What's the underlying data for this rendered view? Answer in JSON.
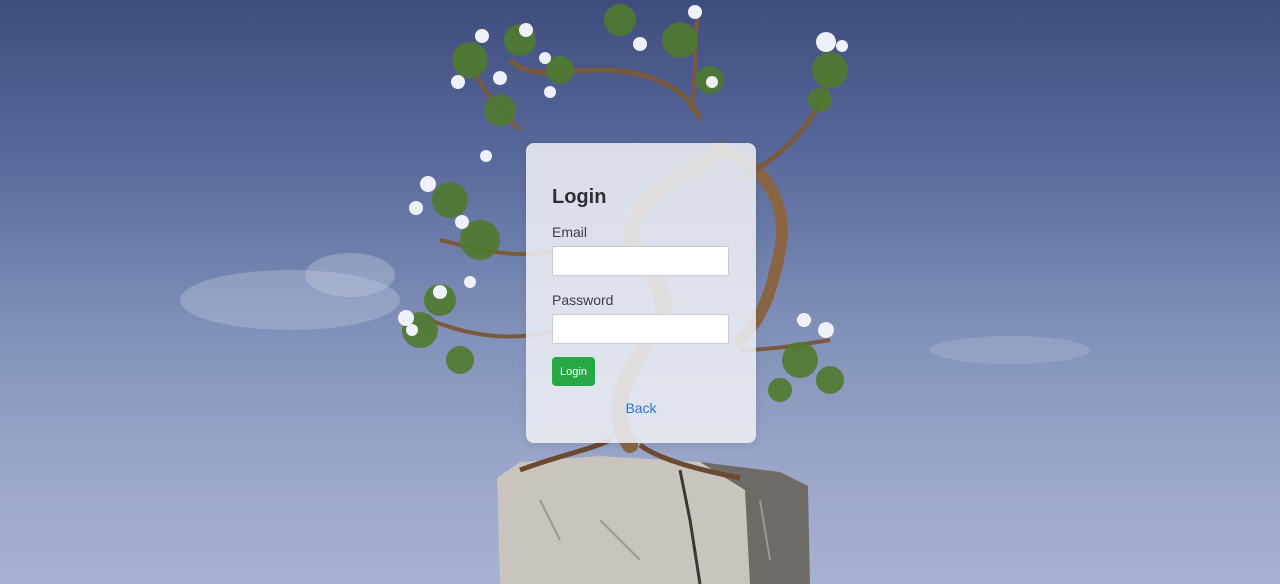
{
  "login_form": {
    "title": "Login",
    "email_label": "Email",
    "email_value": "",
    "password_label": "Password",
    "password_value": "",
    "submit_label": "Login",
    "back_label": "Back"
  },
  "colors": {
    "sky_top": "#3f4c7e",
    "sky_bottom": "#a7b1d1",
    "card_background": "#eceef4",
    "button_green": "#28a745",
    "link_blue": "#2f74d8"
  }
}
